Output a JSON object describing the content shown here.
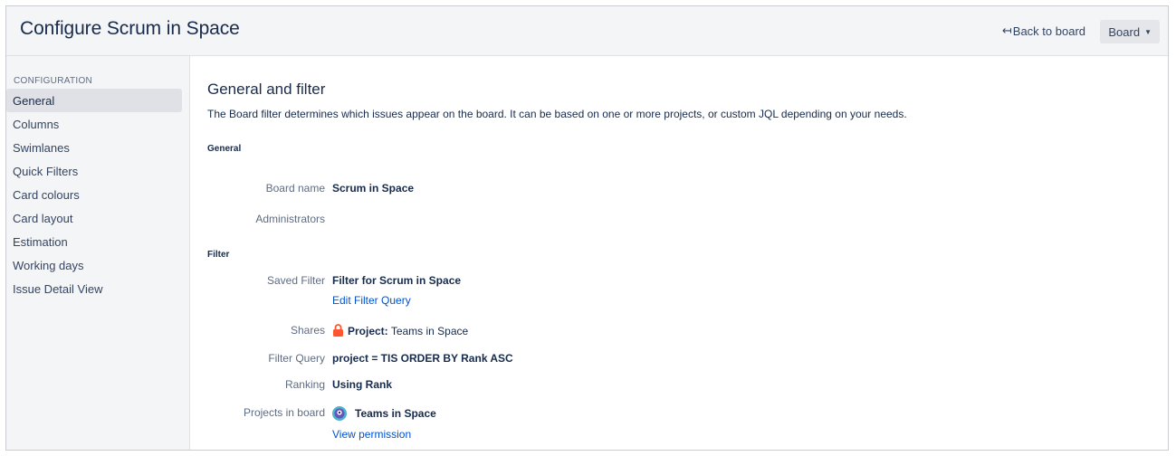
{
  "header": {
    "title": "Configure Scrum in Space",
    "back_label": "Back to board",
    "board_label": "Board"
  },
  "sidebar": {
    "heading": "CONFIGURATION",
    "items": [
      {
        "label": "General"
      },
      {
        "label": "Columns"
      },
      {
        "label": "Swimlanes"
      },
      {
        "label": "Quick Filters"
      },
      {
        "label": "Card colours"
      },
      {
        "label": "Card layout"
      },
      {
        "label": "Estimation"
      },
      {
        "label": "Working days"
      },
      {
        "label": "Issue Detail View"
      }
    ]
  },
  "main": {
    "title": "General and filter",
    "description": "The Board filter determines which issues appear on the board. It can be based on one or more projects, or custom JQL depending on your needs.",
    "general_heading": "General",
    "board_name_label": "Board name",
    "board_name": "Scrum in Space",
    "administrators_label": "Administrators",
    "filter_heading": "Filter",
    "saved_filter_label": "Saved Filter",
    "saved_filter": "Filter for Scrum in Space",
    "edit_filter_link": "Edit Filter Query",
    "shares_label": "Shares",
    "shares_prefix": "Project:",
    "shares_value": "Teams in Space",
    "filter_query_label": "Filter Query",
    "filter_query": "project = TIS ORDER BY Rank ASC",
    "ranking_label": "Ranking",
    "ranking": "Using Rank",
    "projects_label": "Projects in board",
    "project_name": "Teams in Space",
    "view_permission_link": "View permission"
  },
  "icons": {
    "back": "left-arrow-icon",
    "board_caret": "caret-down-icon",
    "shares": "lock-icon",
    "project": "project-avatar-icon"
  },
  "colors": {
    "link": "#0052cc",
    "lock": "#ff5630",
    "header_bg": "#f4f5f7"
  }
}
